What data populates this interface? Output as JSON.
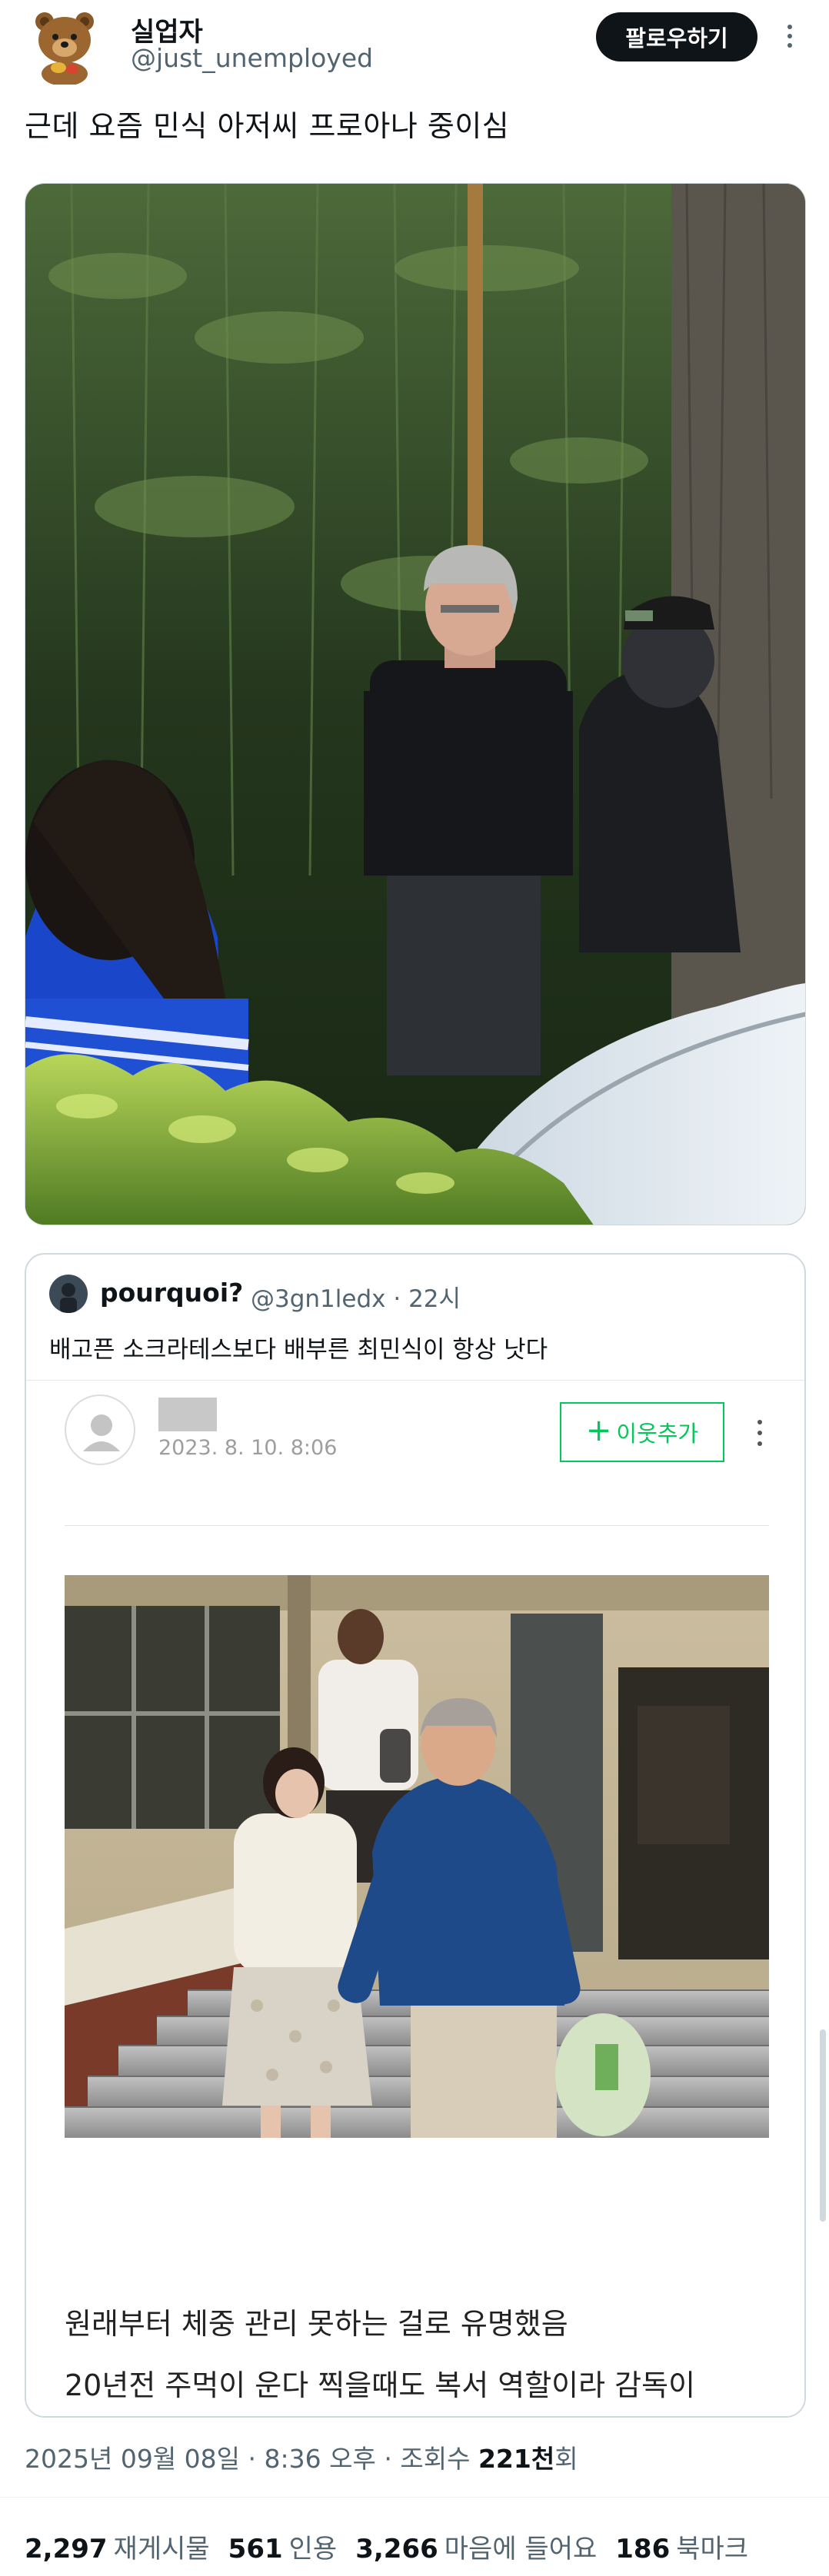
{
  "author": {
    "display_name": "실업자",
    "handle": "@just_unemployed",
    "avatar_icon": "bear-avatar-icon"
  },
  "follow_label": "팔로우하기",
  "tweet": {
    "text": "근데 요즘 민식 아저씨 프로아나 중이심"
  },
  "quote": {
    "name": "pourquoi?",
    "handle": "@3gn1ledx",
    "time": "22시",
    "text": "배고픈 소크라테스보다 배부른 최민식이 항상 낫다",
    "blog": {
      "date": "2023. 8. 10. 8:06",
      "neighbor_plus": "+",
      "neighbor_label": "이웃추가",
      "line1": "원래부터 체중 관리 못하는 걸로 유명했음",
      "line2": "20년전 주먹이 운다 찍을때도 복서 역할이라 감독이"
    }
  },
  "meta": {
    "date": "2025년 09월 08일",
    "dot": "·",
    "time": "8:36 오후",
    "views_label": "조회수",
    "views_value": "221천",
    "views_suffix": "회"
  },
  "stats": {
    "retweets": "2,297",
    "retweets_label": "재게시물",
    "quotes": "561",
    "quotes_label": "인용",
    "likes": "3,266",
    "likes_label": "마음에 들어요",
    "bookmarks": "186",
    "bookmarks_label": "북마크"
  },
  "colors": {
    "follow_bg": "#0f1419",
    "secondary_text": "#536471",
    "neighbor_green": "#03c75a",
    "border": "#cfd9de"
  }
}
